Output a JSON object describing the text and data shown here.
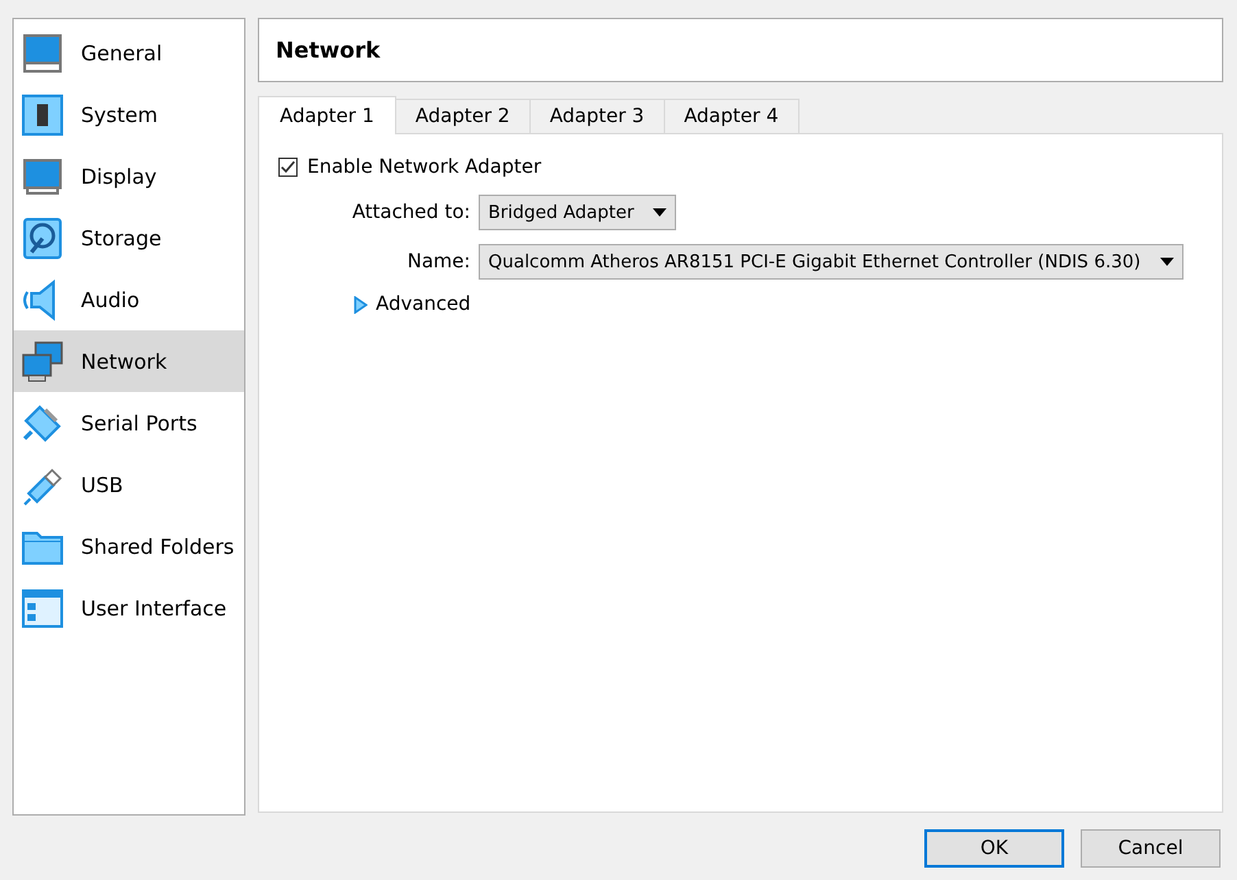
{
  "sidebar": {
    "items": [
      {
        "label": "General",
        "selected": false
      },
      {
        "label": "System",
        "selected": false
      },
      {
        "label": "Display",
        "selected": false
      },
      {
        "label": "Storage",
        "selected": false
      },
      {
        "label": "Audio",
        "selected": false
      },
      {
        "label": "Network",
        "selected": true
      },
      {
        "label": "Serial Ports",
        "selected": false
      },
      {
        "label": "USB",
        "selected": false
      },
      {
        "label": "Shared Folders",
        "selected": false
      },
      {
        "label": "User Interface",
        "selected": false
      }
    ]
  },
  "page_title": "Network",
  "tabs": [
    {
      "label": "Adapter 1",
      "selected": true
    },
    {
      "label": "Adapter 2",
      "selected": false
    },
    {
      "label": "Adapter 3",
      "selected": false
    },
    {
      "label": "Adapter 4",
      "selected": false
    }
  ],
  "adapter": {
    "enable": {
      "label": "Enable Network Adapter",
      "checked": true
    },
    "attached_to": {
      "label": "Attached to:",
      "value": "Bridged Adapter"
    },
    "name": {
      "label": "Name:",
      "value": "Qualcomm Atheros AR8151 PCI-E Gigabit Ethernet Controller (NDIS 6.30)"
    },
    "advanced": {
      "label": "Advanced",
      "expanded": false
    }
  },
  "buttons": [
    {
      "label": "OK",
      "default": true
    },
    {
      "label": "Cancel",
      "default": false
    }
  ]
}
